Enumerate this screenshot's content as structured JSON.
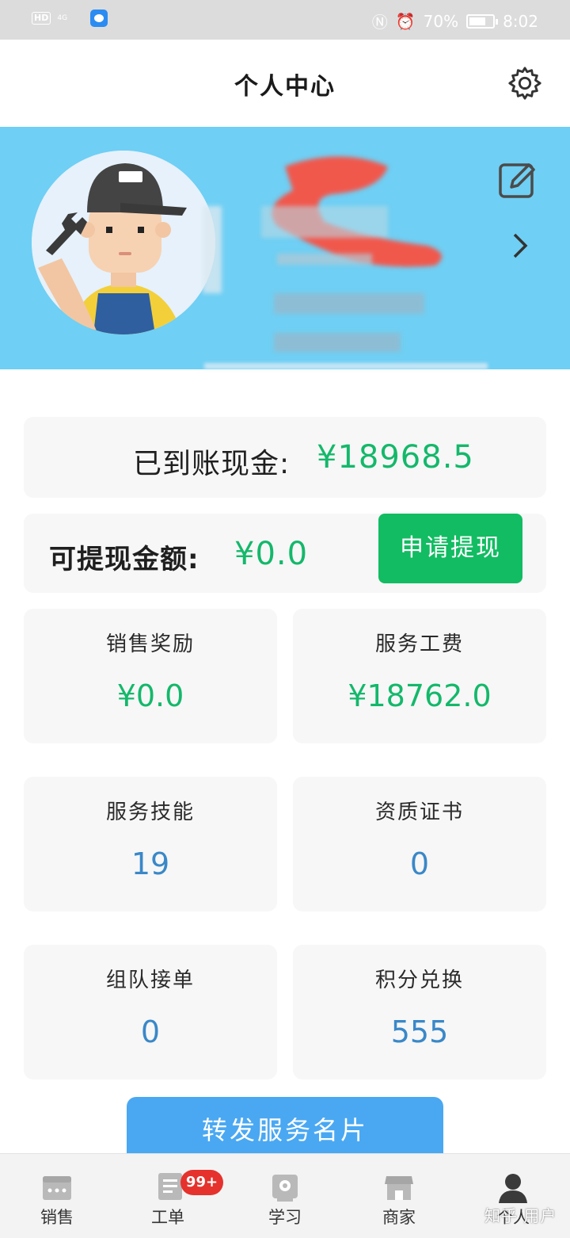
{
  "status_bar": {
    "hd": "HD",
    "signal": "4G",
    "battery": "70%",
    "time": "8:02"
  },
  "header": {
    "title": "个人中心",
    "settings_icon": "gear-icon"
  },
  "profile": {
    "avatar": "technician-avatar",
    "edit_icon": "edit-icon",
    "chevron": "chevron-right-icon"
  },
  "earnings": {
    "received_label": "已到账现金:",
    "received_value": "¥18968.5",
    "withdrawable_label": "可提现金额:",
    "withdrawable_value": "¥0.0",
    "withdraw_button": "申请提现"
  },
  "tiles": [
    {
      "label": "销售奖励",
      "value": "¥0.0"
    },
    {
      "label": "服务工费",
      "value": "¥18762.0"
    },
    {
      "label": "服务技能",
      "value": "19"
    },
    {
      "label": "资质证书",
      "value": "0"
    },
    {
      "label": "组队接单",
      "value": "0"
    },
    {
      "label": "积分兑换",
      "value": "555"
    }
  ],
  "share_button": "转发服务名片",
  "bottom_nav": {
    "items": [
      {
        "label": "销售",
        "icon": "sales-icon"
      },
      {
        "label": "工单",
        "icon": "work-order-icon",
        "badge": "99+"
      },
      {
        "label": "学习",
        "icon": "study-icon"
      },
      {
        "label": "商家",
        "icon": "store-icon"
      },
      {
        "label": "个人",
        "icon": "user-icon"
      }
    ]
  },
  "watermark": "知乎 用户",
  "colors": {
    "banner": "#6fcff4",
    "green": "#14b86b",
    "blue": "#3a88c8",
    "button_green": "#12bc62",
    "share_blue": "#4aa8f2",
    "badge_red": "#e5322d"
  }
}
